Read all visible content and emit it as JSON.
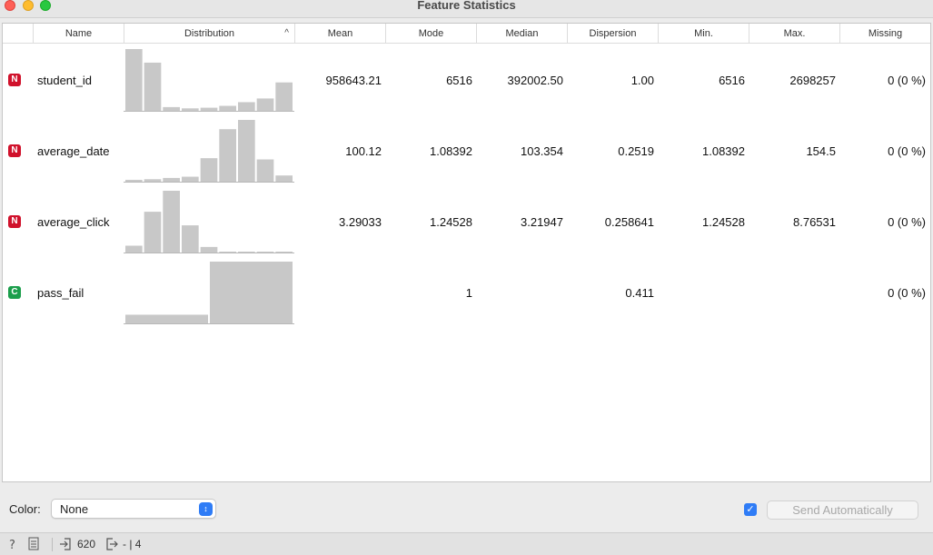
{
  "window": {
    "title": "Feature Statistics"
  },
  "table": {
    "headers": {
      "name": "Name",
      "distribution": "Distribution",
      "sort_indicator": "^",
      "mean": "Mean",
      "mode": "Mode",
      "median": "Median",
      "dispersion": "Dispersion",
      "min": "Min.",
      "max": "Max.",
      "missing": "Missing"
    },
    "rows": [
      {
        "type_badge": "N",
        "type": "numeric",
        "name": "student_id",
        "mean": "958643.21",
        "mode": "6516",
        "median": "392002.50",
        "dispersion": "1.00",
        "min": "6516",
        "max": "2698257",
        "missing": "0 (0 %)",
        "histogram": [
          1.0,
          0.78,
          0.06,
          0.04,
          0.05,
          0.08,
          0.14,
          0.2,
          0.46
        ]
      },
      {
        "type_badge": "N",
        "type": "numeric",
        "name": "average_date",
        "mean": "100.12",
        "mode": "1.08392",
        "median": "103.354",
        "dispersion": "0.2519",
        "min": "1.08392",
        "max": "154.5",
        "missing": "0 (0 %)",
        "histogram": [
          0.03,
          0.04,
          0.06,
          0.08,
          0.38,
          0.85,
          1.0,
          0.36,
          0.1
        ]
      },
      {
        "type_badge": "N",
        "type": "numeric",
        "name": "average_click",
        "mean": "3.29033",
        "mode": "1.24528",
        "median": "3.21947",
        "dispersion": "0.258641",
        "min": "1.24528",
        "max": "8.76531",
        "missing": "0 (0 %)",
        "histogram": [
          0.11,
          0.66,
          1.0,
          0.44,
          0.09,
          0.01,
          0.005,
          0.003,
          0.002
        ]
      },
      {
        "type_badge": "C",
        "type": "categorical",
        "name": "pass_fail",
        "mean": "",
        "mode": "1",
        "median": "",
        "dispersion": "0.411",
        "min": "",
        "max": "",
        "missing": "0 (0 %)",
        "histogram": [
          0.14,
          1.0
        ]
      }
    ]
  },
  "controls": {
    "color_label": "Color:",
    "color_value": "None",
    "send_checked": true,
    "send_label": "Send Automatically"
  },
  "status": {
    "input_count": "620",
    "output_count": "- | 4"
  },
  "colors": {
    "numeric_badge": "#d0112b",
    "categorical_badge": "#1b9e4b",
    "histogram_bar": "#c8c8c8",
    "accent": "#2f7cf6"
  }
}
